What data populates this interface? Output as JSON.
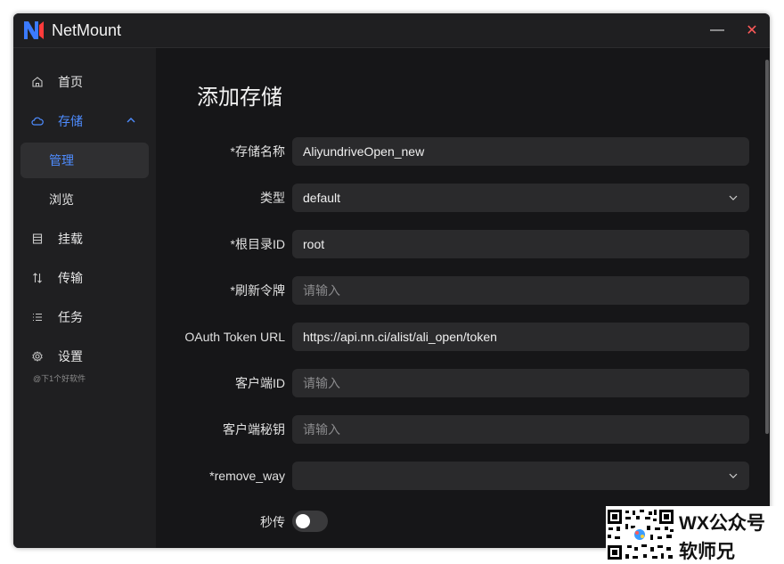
{
  "app": {
    "title": "NetMount"
  },
  "window_controls": {
    "minimize": "—",
    "close": "✕"
  },
  "sidebar": {
    "items": [
      {
        "label": "首页",
        "icon": "home-icon"
      },
      {
        "label": "存储",
        "icon": "cloud-icon",
        "expanded": true
      },
      {
        "label": "管理",
        "sub": true,
        "selected": true
      },
      {
        "label": "浏览",
        "sub": true
      },
      {
        "label": "挂载",
        "icon": "mount-icon"
      },
      {
        "label": "传输",
        "icon": "transfer-icon"
      },
      {
        "label": "任务",
        "icon": "list-icon"
      },
      {
        "label": "设置",
        "icon": "gear-icon"
      }
    ],
    "footer_note": "@下1个好软件"
  },
  "page": {
    "title": "添加存储"
  },
  "form": {
    "storage_name": {
      "label": "*存储名称",
      "value": "AliyundriveOpen_new"
    },
    "type": {
      "label": "类型",
      "value": "default"
    },
    "root_id": {
      "label": "*根目录ID",
      "value": "root"
    },
    "refresh_token": {
      "label": "*刷新令牌",
      "placeholder": "请输入"
    },
    "oauth_url": {
      "label": "OAuth Token URL",
      "value": "https://api.nn.ci/alist/ali_open/token"
    },
    "client_id": {
      "label": "客户端ID",
      "placeholder": "请输入"
    },
    "client_secret": {
      "label": "客户端秘钥",
      "placeholder": "请输入"
    },
    "remove_way": {
      "label": "*remove_way",
      "value": ""
    },
    "rapid_upload": {
      "label": "秒传",
      "on": false
    }
  },
  "overlay": {
    "line1": "WX公众号",
    "line2": "软师兄"
  },
  "colors": {
    "accent": "#4e8cff",
    "background": "#161618",
    "sidebar": "#1f1f21",
    "field": "#2a2a2c",
    "close": "#ff5a5a"
  }
}
